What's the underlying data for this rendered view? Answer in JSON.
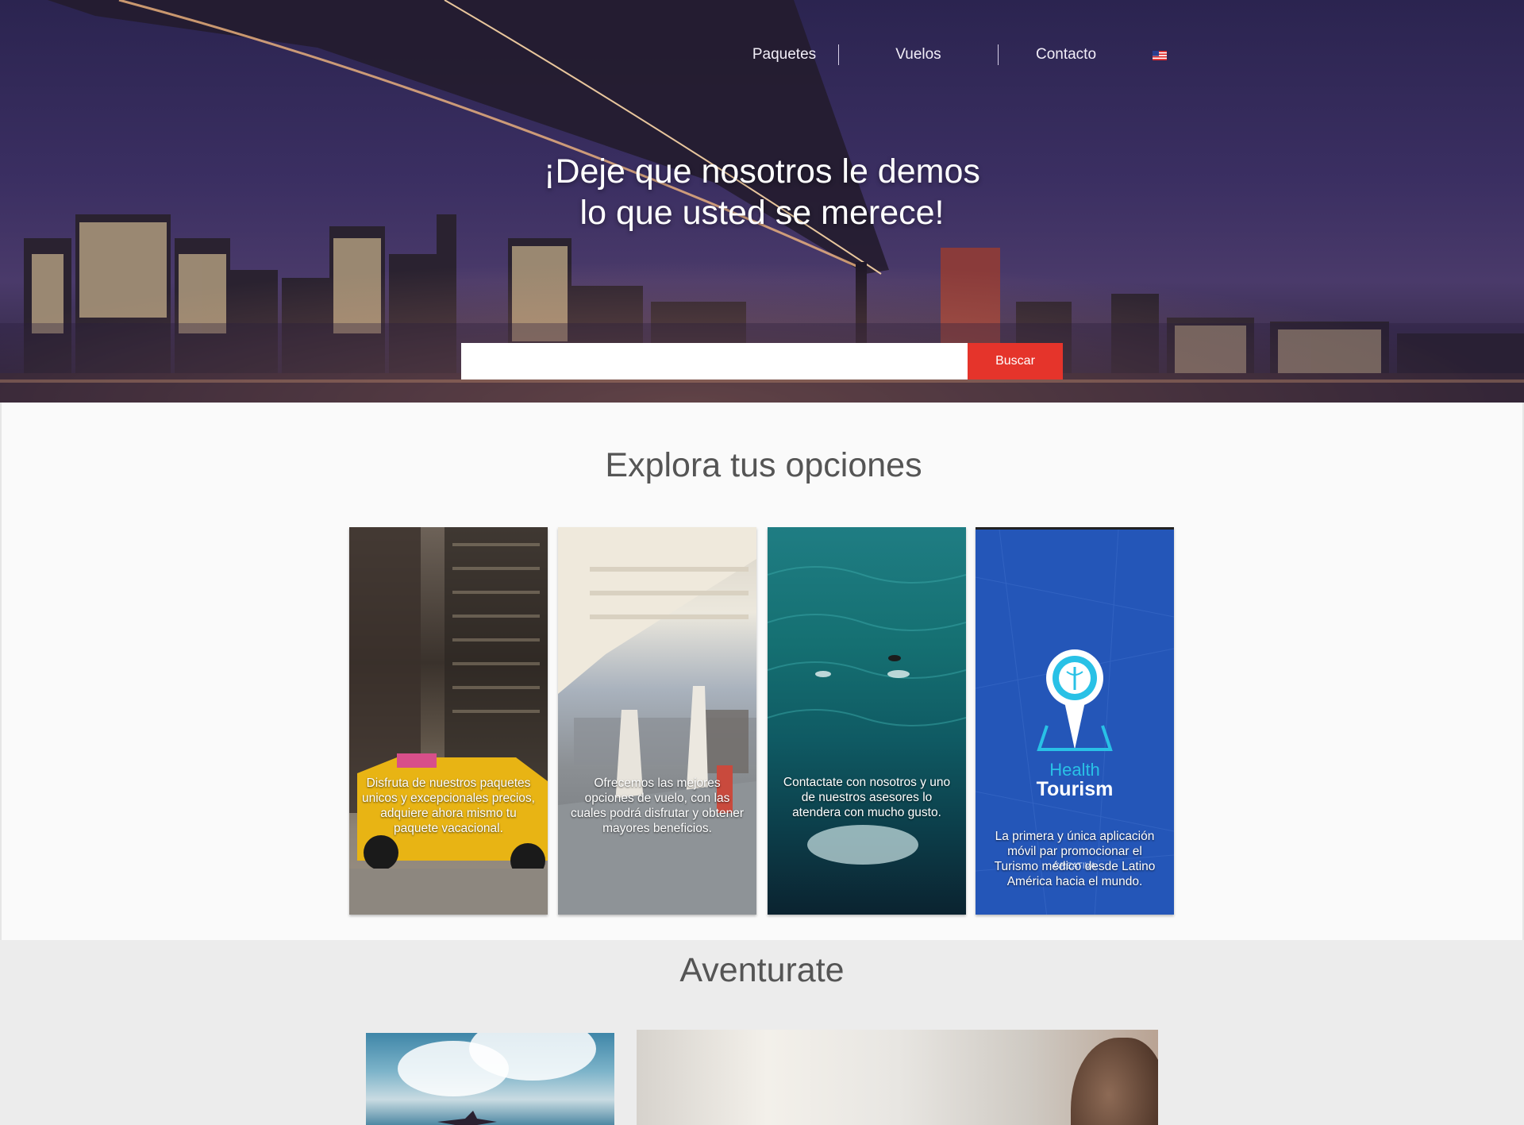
{
  "nav": {
    "items": [
      {
        "label": "Paquetes"
      },
      {
        "label": "Vuelos"
      },
      {
        "label": "Contacto"
      }
    ],
    "language_flag": "us-flag-icon"
  },
  "hero": {
    "headline_line1": "¡Deje que nosotros le demos",
    "headline_line2": "lo que usted se merece!",
    "search_placeholder": "",
    "search_button": "Buscar"
  },
  "explore": {
    "title": "Explora tus opciones",
    "cards": [
      {
        "text": "Disfruta de nuestros paquetes unicos y excepcionales precios, adquiere ahora mismo tu paquete vacacional."
      },
      {
        "text": "Ofrecemos las mejores opciones de vuelo, con las cuales podrá disfrutar y obtener mayores beneficios."
      },
      {
        "text": "Contactate con nosotros y uno de nuestros asesores lo atendera con mucho gusto."
      },
      {
        "text": "La primera y única aplicación móvil par promocionar el Turismo médico desde Latino América hacia el mundo.",
        "logo_word1": "Health",
        "logo_word2": "Tourism",
        "watermark": "CREATIVA"
      }
    ]
  },
  "adventure": {
    "title": "Aventurate"
  },
  "colors": {
    "accent": "#e5342b",
    "health_blue": "#2456b8",
    "health_cyan": "#29c1e6"
  }
}
